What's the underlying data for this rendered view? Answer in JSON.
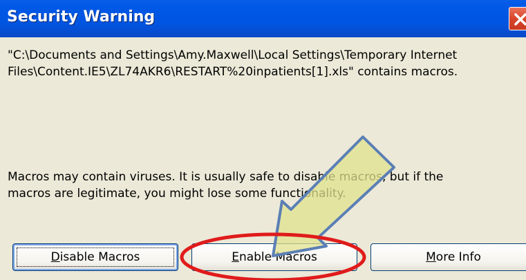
{
  "dialog": {
    "title": "Security Warning",
    "message_lines": [
      "\"C:\\Documents and Settings\\Amy.Maxwell\\Local Settings\\Temporary Internet",
      "Files\\Content.IE5\\ZL74AKR6\\RESTART%20inpatients[1].xls\" contains macros."
    ],
    "warning_lines": [
      "Macros may contain viruses. It is usually safe to disable macros, but if the",
      "macros are legitimate, you might lose some functionality."
    ]
  },
  "buttons": {
    "disable": {
      "mnemonic": "D",
      "rest": "isable Macros"
    },
    "enable": {
      "mnemonic": "E",
      "rest": "nable Macros"
    },
    "more_info": {
      "mnemonic": "M",
      "rest": "ore Info"
    }
  },
  "annotation": {
    "arrow_color": "#5b7fb5",
    "arrow_fill": "#e2e28f",
    "ellipse_color": "#e01b1b"
  },
  "colors": {
    "titlebar": "#0055e1",
    "dialog_bg": "#ece9d8",
    "close_button": "#d9462c"
  }
}
